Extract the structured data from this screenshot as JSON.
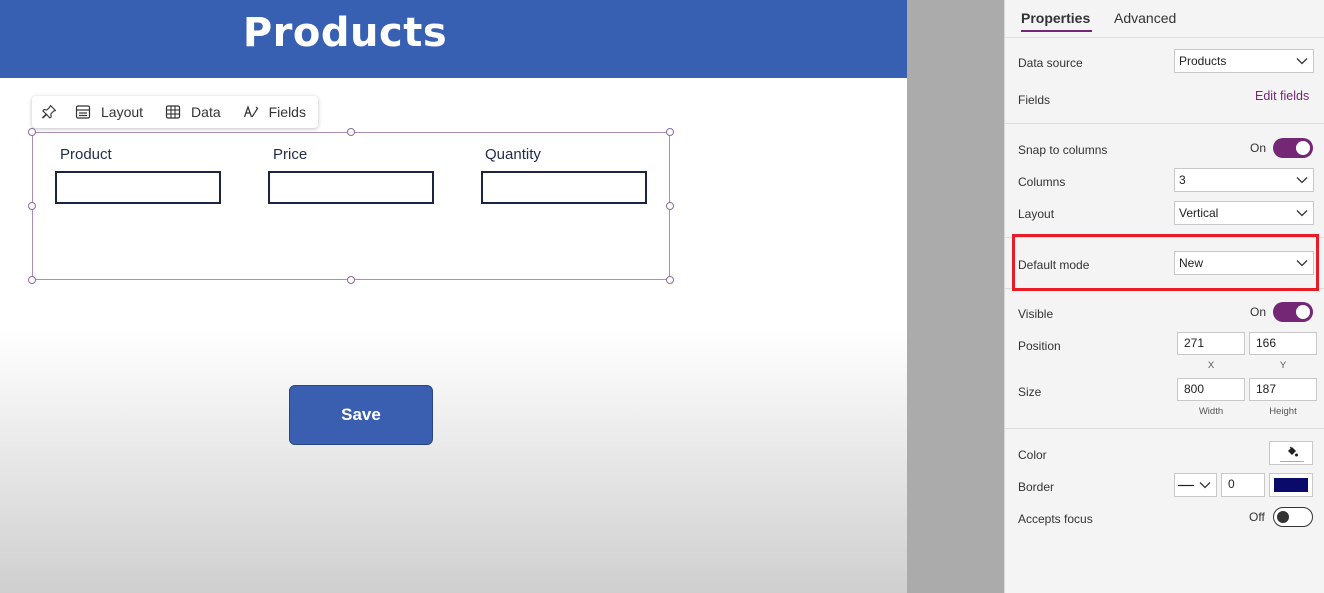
{
  "app": {
    "title": "Products"
  },
  "toolbar": {
    "layout": "Layout",
    "data": "Data",
    "fields": "Fields"
  },
  "form": {
    "fields": [
      {
        "label": "Product"
      },
      {
        "label": "Price"
      },
      {
        "label": "Quantity"
      }
    ]
  },
  "save_button": {
    "label": "Save"
  },
  "props": {
    "tabs": [
      "Properties",
      "Advanced"
    ],
    "data_source": {
      "label": "Data source",
      "value": "Products"
    },
    "fields": {
      "label": "Fields",
      "link": "Edit fields"
    },
    "snap": {
      "label": "Snap to columns",
      "state": "On"
    },
    "columns": {
      "label": "Columns",
      "value": "3"
    },
    "layout": {
      "label": "Layout",
      "value": "Vertical"
    },
    "default_mode": {
      "label": "Default mode",
      "value": "New"
    },
    "visible": {
      "label": "Visible",
      "state": "On"
    },
    "position": {
      "label": "Position",
      "x": "271",
      "y": "166",
      "x_label": "X",
      "y_label": "Y"
    },
    "size": {
      "label": "Size",
      "width": "800",
      "height": "187",
      "width_label": "Width",
      "height_label": "Height"
    },
    "color": {
      "label": "Color"
    },
    "border": {
      "label": "Border",
      "value": "0",
      "color": "#0a0a6b"
    },
    "accepts_focus": {
      "label": "Accepts focus",
      "state": "Off"
    }
  },
  "colors": {
    "header": "#3860b2",
    "accent": "#742774",
    "highlight": "#e81c24"
  }
}
